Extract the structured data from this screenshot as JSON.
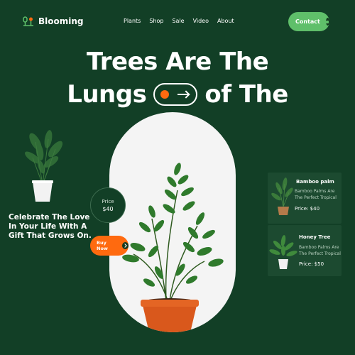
{
  "brand": {
    "name": "Blooming",
    "accent": "#5fbf6a",
    "background": "#123f26",
    "orange": "#ff6a0f"
  },
  "nav": {
    "items": [
      "Plants",
      "Shop",
      "Sale",
      "Video",
      "About"
    ],
    "contact_label": "Contact"
  },
  "hero": {
    "line1": "Trees Are The",
    "line2_left": "Lungs",
    "line2_right": "of The"
  },
  "side": {
    "tagline": "Celebrate The Love In Your Life With A Gift That Grows On."
  },
  "featured": {
    "price_label": "Price",
    "price_value": "$40",
    "buy_label": "Buy Now"
  },
  "cards": [
    {
      "title": "Bamboo palm",
      "desc": "Bamboo Palms Are The Perfect Tropical",
      "price": "Price: $40"
    },
    {
      "title": "Honey Tree",
      "desc": "Bamboo Palms Are The Perfect Tropical",
      "price": "Price: $50"
    }
  ]
}
